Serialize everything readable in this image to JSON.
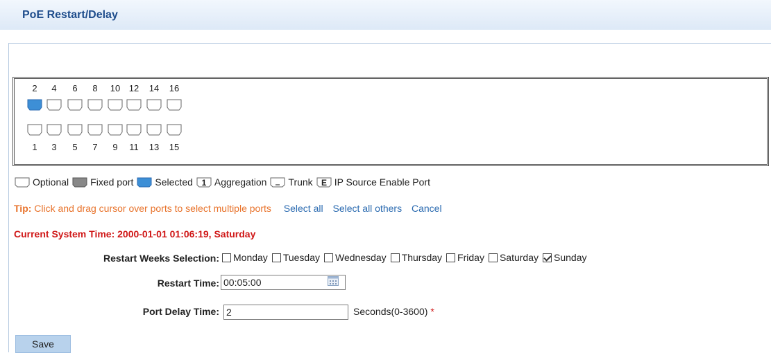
{
  "header": {
    "title": "PoE Restart/Delay"
  },
  "ports": {
    "top_numbers": [
      "2",
      "4",
      "6",
      "8",
      "10",
      "12",
      "14",
      "16"
    ],
    "bottom_numbers": [
      "1",
      "3",
      "5",
      "7",
      "9",
      "11",
      "13",
      "15"
    ],
    "selected": [
      "2"
    ]
  },
  "legend": {
    "optional": "Optional",
    "fixed": "Fixed port",
    "selected": "Selected",
    "aggregation": "Aggregation",
    "aggregation_glyph": "1",
    "trunk": "Trunk",
    "ipsource": "IP Source Enable Port",
    "ipsource_glyph": "E"
  },
  "tip": {
    "label": "Tip:",
    "text": "Click and drag cursor over ports to select multiple ports",
    "select_all": "Select all",
    "select_others": "Select all others",
    "cancel": "Cancel"
  },
  "system_time": "Current System Time: 2000-01-01 01:06:19, Saturday",
  "form": {
    "weeks_label": "Restart Weeks Selection:",
    "days": [
      {
        "label": "Monday",
        "checked": false
      },
      {
        "label": "Tuesday",
        "checked": false
      },
      {
        "label": "Wednesday",
        "checked": false
      },
      {
        "label": "Thursday",
        "checked": false
      },
      {
        "label": "Friday",
        "checked": false
      },
      {
        "label": "Saturday",
        "checked": false
      },
      {
        "label": "Sunday",
        "checked": true
      }
    ],
    "restart_time_label": "Restart Time:",
    "restart_time_value": "00:05:00",
    "delay_label": "Port Delay Time:",
    "delay_value": "2",
    "delay_unit": "Seconds(0-3600)",
    "required_mark": "*"
  },
  "buttons": {
    "save": "Save"
  },
  "colors": {
    "selected_port": "#3d8fd6",
    "fixed_port": "#888888",
    "accent_red": "#d01818",
    "tip_orange": "#e8722a",
    "link_blue": "#2a6ab0"
  }
}
